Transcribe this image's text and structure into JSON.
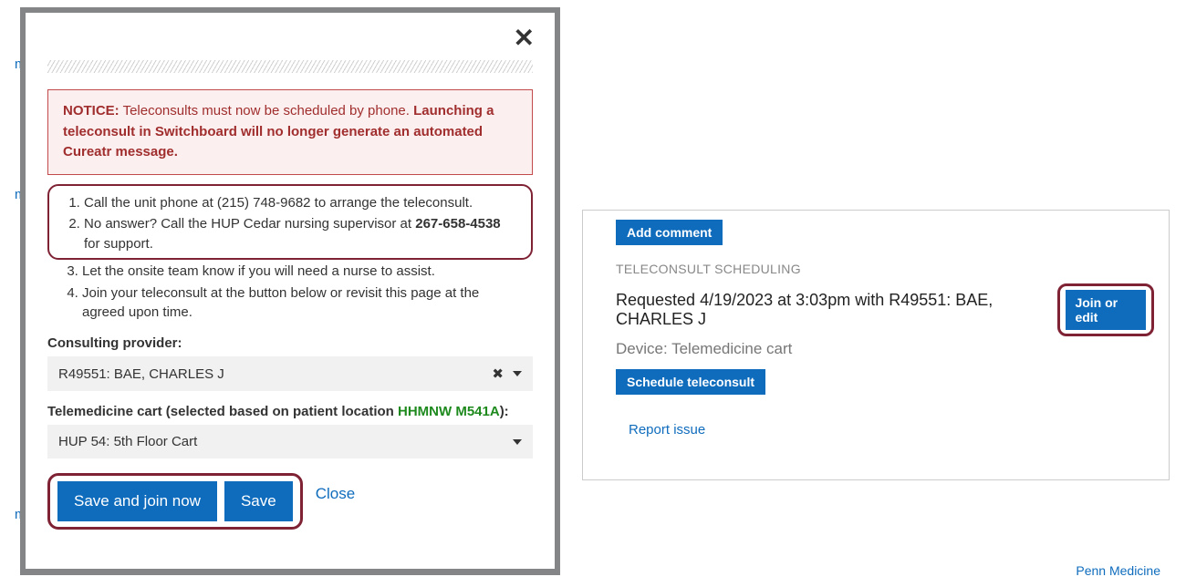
{
  "bg": {
    "t1": "m",
    "t2": "m",
    "t3": "m"
  },
  "modal": {
    "notice_prefix": "NOTICE:",
    "notice_lead": " Teleconsults must now be scheduled by phone. ",
    "notice_bold": "Launching a teleconsult in Switchboard will no longer generate an automated Cureatr message.",
    "step1": "Call the unit phone at (215) 748-9682 to arrange the teleconsult.",
    "step2_a": "No answer? Call the HUP Cedar nursing supervisor at ",
    "step2_phone": "267-658-4538",
    "step2_b": " for support.",
    "step3": "Let the onsite team know if you will need a nurse to assist.",
    "step4": "Join your teleconsult at the button below or revisit this page at the agreed upon time.",
    "prov_label": "Consulting provider:",
    "prov_value": "R49551: BAE, CHARLES J",
    "cart_label_a": "Telemedicine cart (selected based on patient location ",
    "cart_loc": "HHMNW M541A",
    "cart_label_b": "):",
    "cart_value": "HUP 54: 5th Floor Cart",
    "btn_savejoin": "Save and join now",
    "btn_save": "Save",
    "btn_close": "Close"
  },
  "panel": {
    "add_comment": "Add comment",
    "heading": "TELECONSULT SCHEDULING",
    "line": "Requested 4/19/2023 at 3:03pm with R49551: BAE, CHARLES J",
    "join_edit": "Join or edit",
    "device": "Device: Telemedicine cart",
    "schedule": "Schedule teleconsult",
    "report": "Report issue"
  },
  "footer": {
    "penn": "Penn Medicine"
  }
}
